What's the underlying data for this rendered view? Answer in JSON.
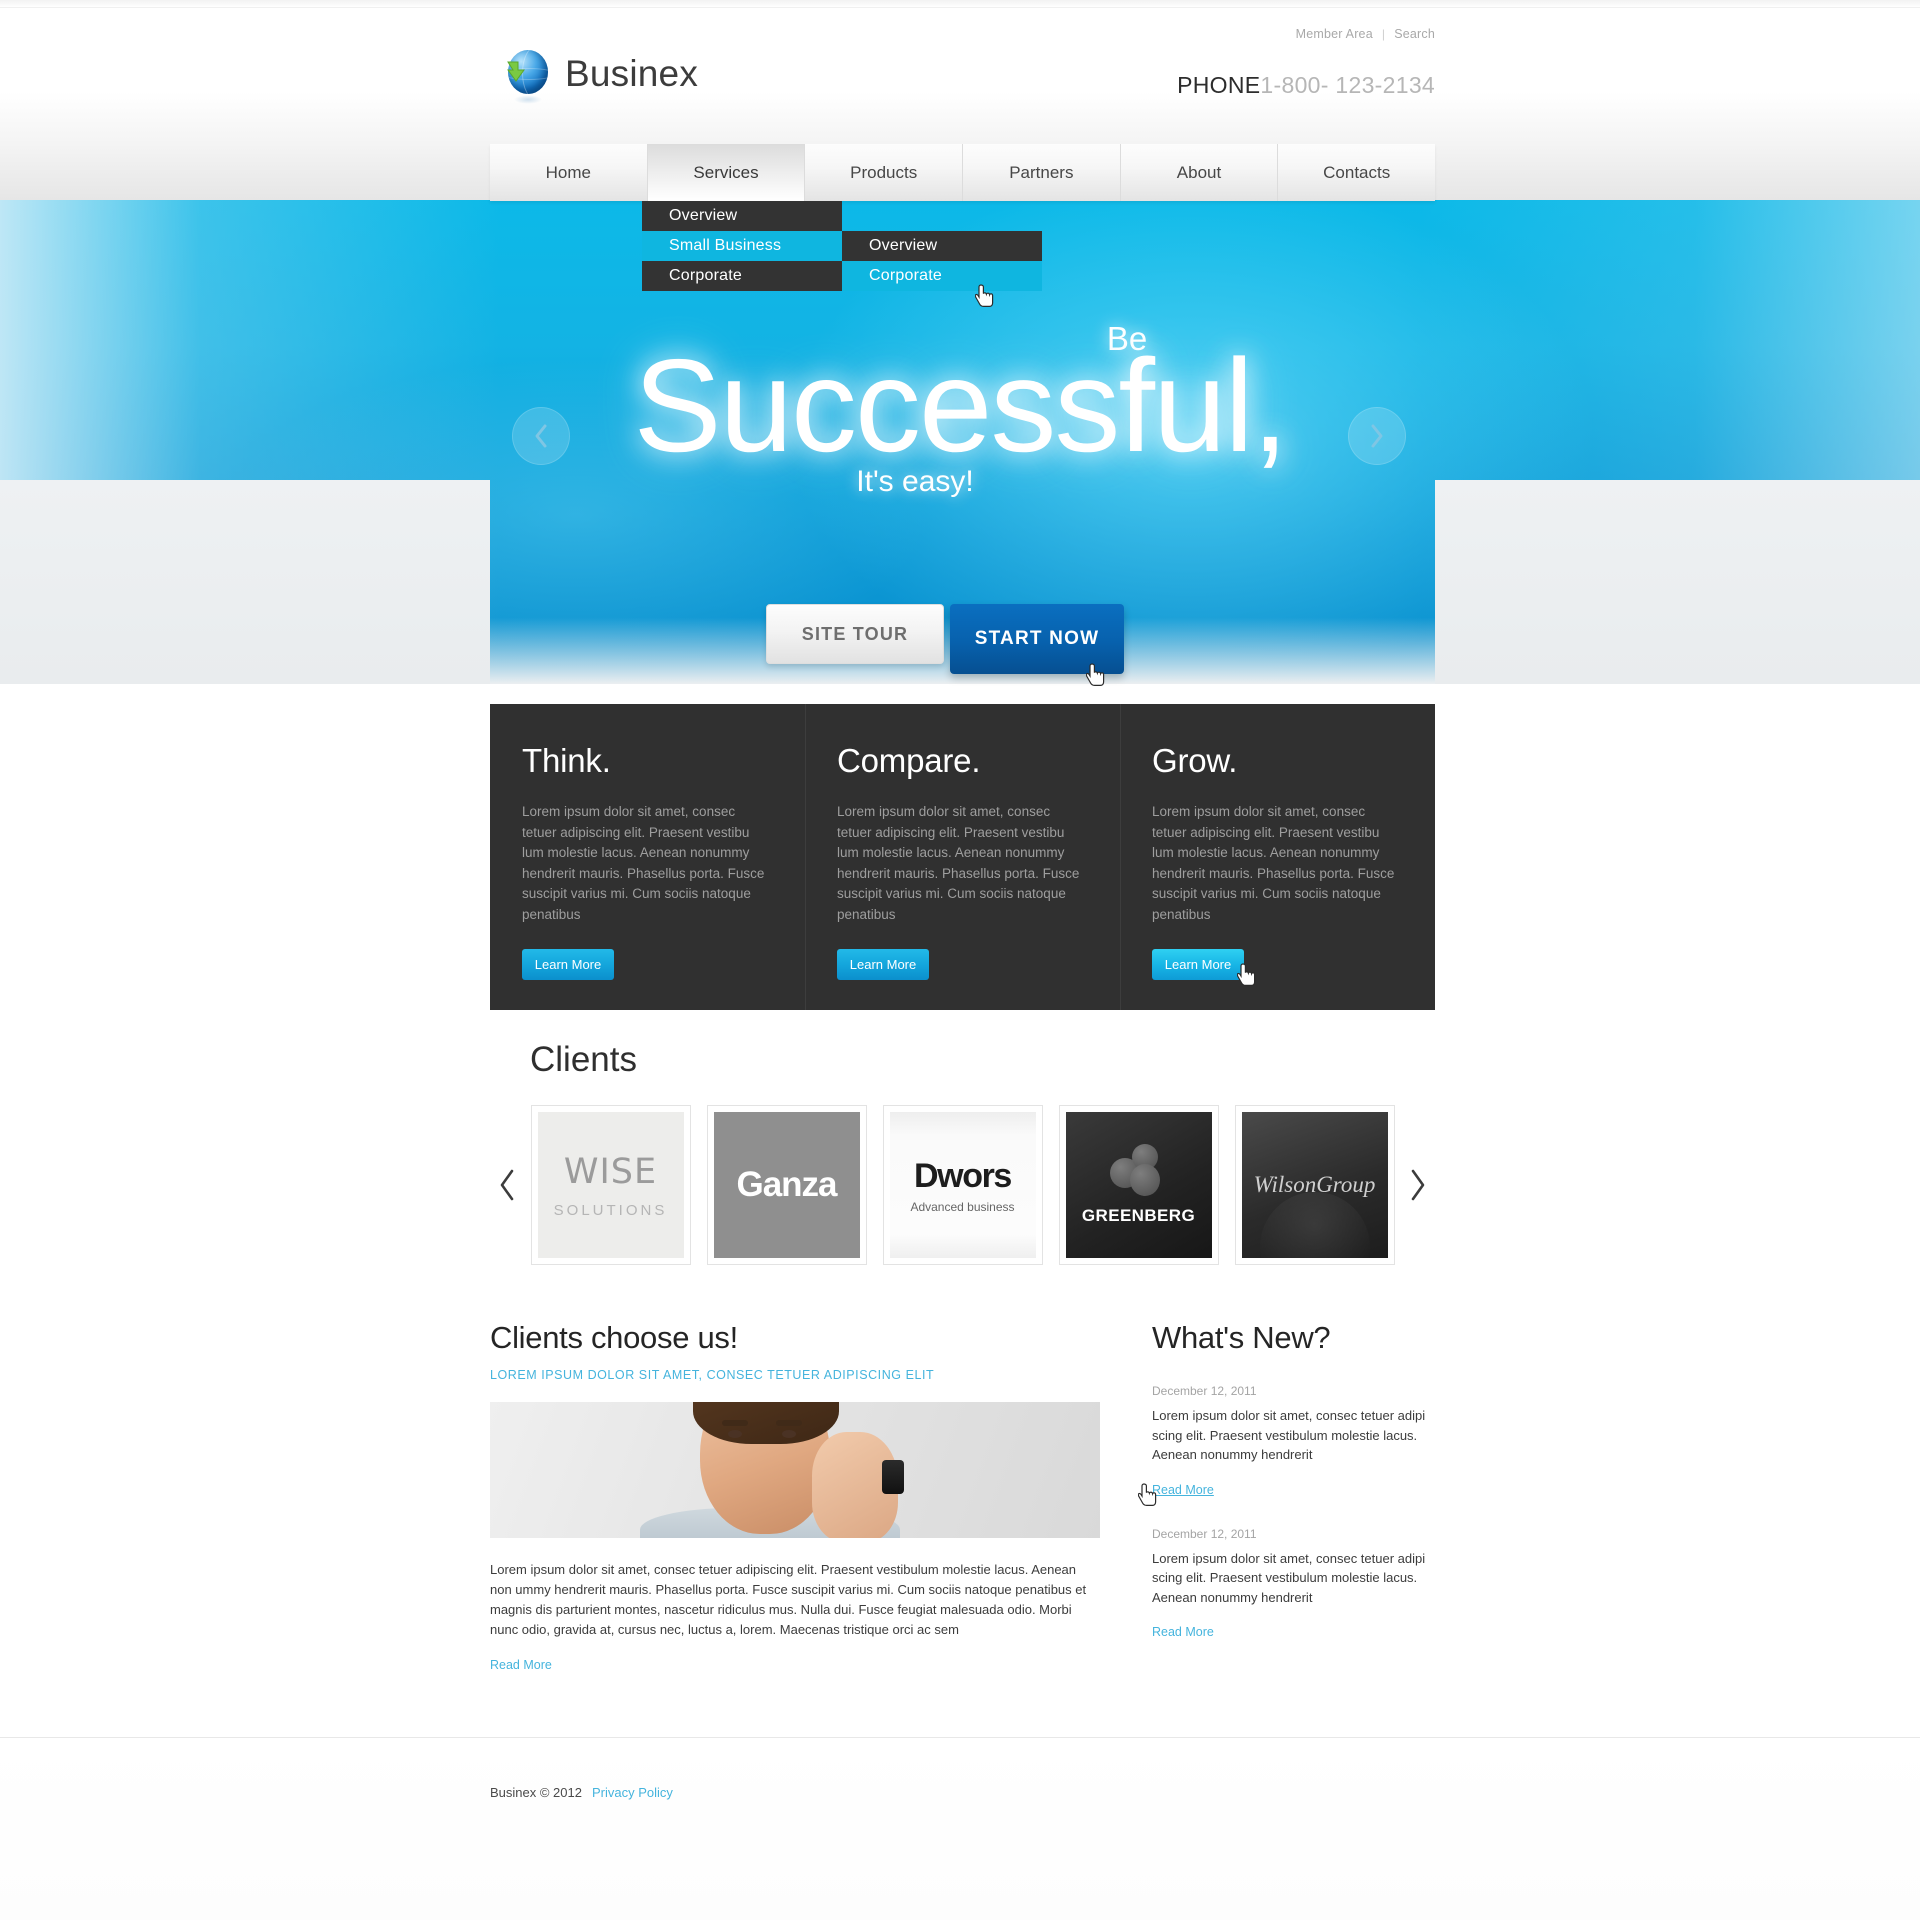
{
  "topbar": {
    "member_area": "Member Area",
    "separator": "|",
    "search": "Search"
  },
  "logo": {
    "brand": "Businex",
    "icon": "globe-icon"
  },
  "phone": {
    "label": "PHONE",
    "number": "1-800- 123-2134"
  },
  "nav": {
    "items": [
      {
        "label": "Home",
        "active": false
      },
      {
        "label": "Services",
        "active": true
      },
      {
        "label": "Products",
        "active": false
      },
      {
        "label": "Partners",
        "active": false
      },
      {
        "label": "About",
        "active": false
      },
      {
        "label": "Contacts",
        "active": false
      }
    ]
  },
  "dropdown": {
    "items": [
      {
        "label": "Overview",
        "highlighted": false
      },
      {
        "label": "Small Business",
        "highlighted": true
      },
      {
        "label": "Corporate",
        "highlighted": false
      }
    ],
    "submenu": [
      {
        "label": "Overview",
        "highlighted": false
      },
      {
        "label": "Corporate",
        "highlighted": true
      }
    ]
  },
  "hero": {
    "pre": "Be",
    "headline": "Successful,",
    "sub": "It's easy!",
    "prev_icon": "chevron-left-icon",
    "next_icon": "chevron-right-icon",
    "btn_tour": "SITE TOUR",
    "btn_start": "START NOW"
  },
  "features": [
    {
      "title": "Think.",
      "text": "Lorem ipsum dolor sit amet, consec tetuer adipiscing elit. Praesent vestibu lum molestie lacus. Aenean nonummy hendrerit mauris. Phasellus porta. Fusce suscipit varius mi. Cum sociis natoque penatibus",
      "button": "Learn More",
      "highlighted": false
    },
    {
      "title": "Compare.",
      "text": "Lorem ipsum dolor sit amet, consec tetuer adipiscing elit. Praesent vestibu lum molestie lacus. Aenean nonummy hendrerit mauris. Phasellus porta. Fusce suscipit varius mi. Cum sociis natoque penatibus",
      "button": "Learn More",
      "highlighted": false
    },
    {
      "title": "Grow.",
      "text": "Lorem ipsum dolor sit amet, consec tetuer adipiscing elit. Praesent vestibu lum molestie lacus. Aenean nonummy hendrerit mauris. Phasellus porta. Fusce suscipit varius mi. Cum sociis natoque penatibus",
      "button": "Learn More",
      "highlighted": true
    }
  ],
  "clients": {
    "title": "Clients",
    "prev_icon": "chevron-left-icon",
    "next_icon": "chevron-right-icon",
    "logos": [
      {
        "name": "WISE",
        "tagline": "SOLUTIONS"
      },
      {
        "name": "Ganza",
        "tagline": ""
      },
      {
        "name": "Dwors",
        "tagline": "Advanced business"
      },
      {
        "name": "GREENBERG",
        "tagline": ""
      },
      {
        "name": "WilsonGroup",
        "tagline": ""
      }
    ]
  },
  "main_article": {
    "title": "Clients choose us!",
    "subtitle": "LOREM IPSUM DOLOR SIT AMET, CONSEC TETUER ADIPISCING ELIT",
    "body": "Lorem ipsum dolor sit amet, consec tetuer adipiscing elit. Praesent vestibulum molestie lacus. Aenean non ummy hendrerit mauris. Phasellus porta. Fusce suscipit varius mi. Cum sociis natoque penatibus et magnis dis parturient montes, nascetur ridiculus mus. Nulla dui. Fusce feugiat malesuada odio. Morbi nunc odio, gravida at, cursus nec, luctus a, lorem. Maecenas tristique orci ac sem",
    "read_more": "Read More"
  },
  "news": {
    "title": "What's New?",
    "items": [
      {
        "date": "December 12, 2011",
        "body": "Lorem ipsum dolor sit amet, consec tetuer adipi scing elit. Praesent vestibulum molestie lacus. Aenean nonummy hendrerit",
        "read_more": "Read More",
        "hovered": true
      },
      {
        "date": "December 12, 2011",
        "body": "Lorem ipsum dolor sit amet, consec tetuer adipi scing elit. Praesent vestibulum molestie lacus. Aenean nonummy hendrerit",
        "read_more": "Read More",
        "hovered": false
      }
    ]
  },
  "footer": {
    "copyright": "Businex © 2012",
    "privacy": "Privacy Policy"
  },
  "colors": {
    "accent_cyan": "#0fb6e0",
    "link_blue": "#45b4dd",
    "dark_panel": "#303030",
    "hero_blue": "#0c9ad6",
    "start_button": "#0761ad"
  }
}
